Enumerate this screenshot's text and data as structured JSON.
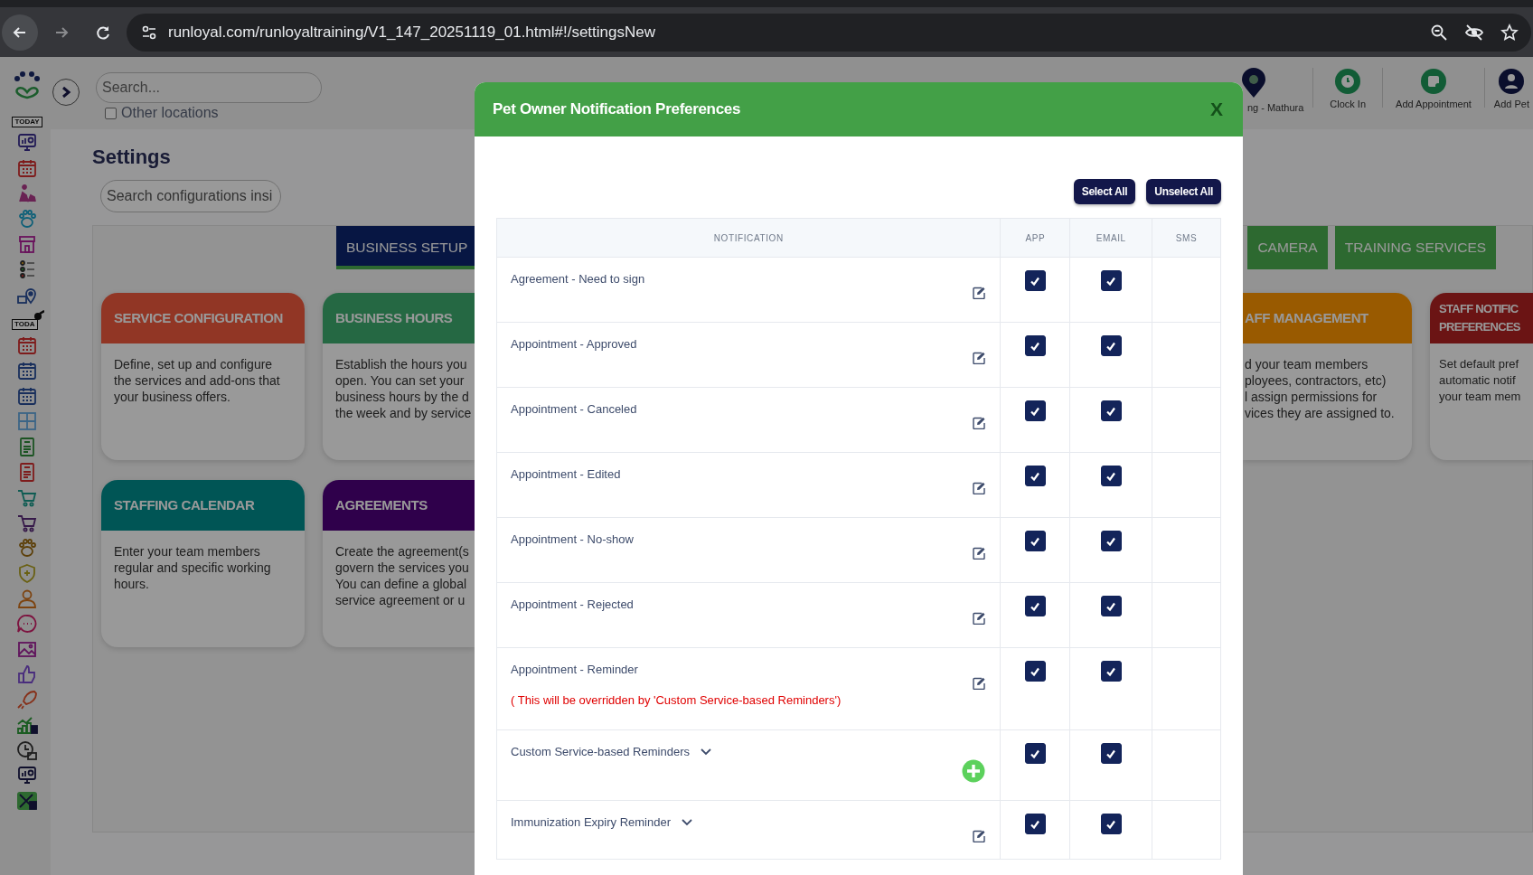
{
  "browser": {
    "url": "runloyal.com/runloyaltraining/V1_147_20251119_01.html#!/settingsNew"
  },
  "sidebar": {
    "badges": [
      "TODAY",
      "TODA"
    ]
  },
  "header": {
    "search": {
      "placeholder": "Search..."
    },
    "other_locations": {
      "label": "Other locations",
      "checked": false
    },
    "toolbar": [
      {
        "label": "ng - Mathura",
        "kind": "location"
      },
      {
        "label": "Clock In",
        "kind": "clock"
      },
      {
        "label": "Add Appointment",
        "kind": "appointment"
      },
      {
        "label": "Add Pet",
        "kind": "pet"
      }
    ]
  },
  "settings": {
    "title": "Settings",
    "search": {
      "placeholder": "Search configurations insi"
    },
    "tabs": [
      {
        "label": "BUSINESS SETUP",
        "selected": true
      },
      {
        "label": "CAMERA",
        "selected": false
      },
      {
        "label": "TRAINING SERVICES",
        "selected": false
      }
    ],
    "card_rows": [
      [
        {
          "title": "SERVICE CONFIGURATION",
          "description": "Define, set up and configure\nthe services and add-ons that\nyour business offers."
        },
        {
          "title": "BUSINESS HOURS",
          "description": "Establish the hours you\nopen. You can set your\nbusiness hours by the d\nthe week and by service"
        },
        {
          "title": "AFF MANAGEMENT",
          "description": "d your team members\nployees, contractors, etc)\nl assign permissions for\nvices they are assigned to."
        },
        {
          "title": "STAFF NOTIFIC\nPREFERENCES",
          "description": "Set default pref\nautomatic notif\nyour team mem"
        }
      ],
      [
        {
          "title": "STAFFING CALENDAR",
          "description": "Enter your team members\nregular and specific working\nhours."
        },
        {
          "title": "AGREEMENTS",
          "description": "Create the agreement(s\ngovern the services you\nYou can define a global\nservice agreement or u"
        }
      ]
    ]
  },
  "modal": {
    "title": "Pet Owner Notification Preferences",
    "close": "X",
    "buttons": [
      "Select All",
      "Unselect All"
    ],
    "columns": [
      "NOTIFICATION",
      "APP",
      "EMAIL",
      "SMS"
    ],
    "rows": [
      {
        "label": "Agreement - Need to sign",
        "kind": "edit",
        "app": true,
        "email": true
      },
      {
        "label": "Appointment - Approved",
        "kind": "edit",
        "app": true,
        "email": true
      },
      {
        "label": "Appointment - Canceled",
        "kind": "edit",
        "app": true,
        "email": true
      },
      {
        "label": "Appointment - Edited",
        "kind": "edit",
        "app": true,
        "email": true
      },
      {
        "label": "Appointment - No-show",
        "kind": "edit",
        "app": true,
        "email": true
      },
      {
        "label": "Appointment - Rejected",
        "kind": "edit",
        "app": true,
        "email": true
      },
      {
        "label": "Appointment - Reminder",
        "kind": "edit",
        "note": "( This will be overridden by 'Custom Service-based Reminders')",
        "app": true,
        "email": true
      },
      {
        "label": "Custom Service-based Reminders",
        "expandable": true,
        "kind": "add",
        "app": true,
        "email": true
      },
      {
        "label": "Immunization Expiry Reminder",
        "expandable": true,
        "kind": "edit",
        "app": true,
        "email": true
      }
    ]
  }
}
